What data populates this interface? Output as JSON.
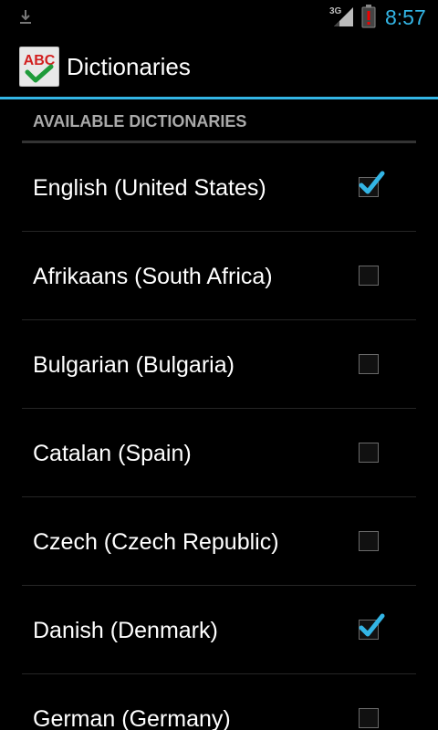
{
  "status_bar": {
    "network": "3G",
    "time": "8:57",
    "icons": [
      "download-icon",
      "signal-icon",
      "battery-alert-icon"
    ]
  },
  "action_bar": {
    "title": "Dictionaries",
    "app_icon_text": "ABC",
    "app_icon": "abc-check-icon"
  },
  "section": {
    "header": "AVAILABLE DICTIONARIES"
  },
  "colors": {
    "accent": "#33b5e5",
    "background": "#000000",
    "header_text": "#aaaaaa"
  },
  "dictionaries": [
    {
      "label": "English (United States)",
      "checked": true
    },
    {
      "label": "Afrikaans (South Africa)",
      "checked": false
    },
    {
      "label": "Bulgarian (Bulgaria)",
      "checked": false
    },
    {
      "label": "Catalan (Spain)",
      "checked": false
    },
    {
      "label": "Czech (Czech Republic)",
      "checked": false
    },
    {
      "label": "Danish (Denmark)",
      "checked": true
    },
    {
      "label": "German (Germany)",
      "checked": false
    }
  ]
}
